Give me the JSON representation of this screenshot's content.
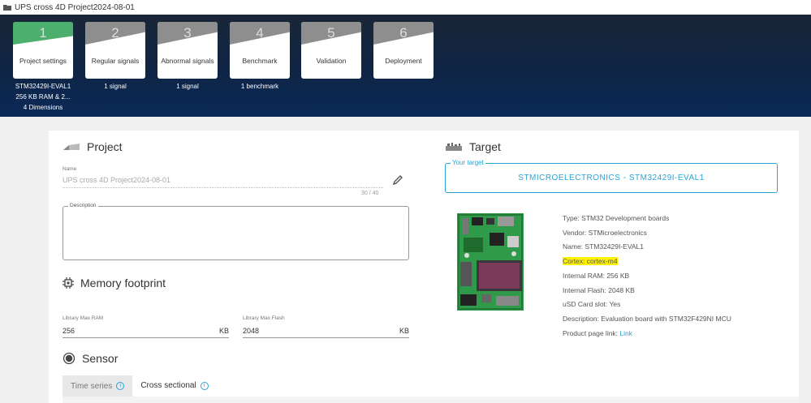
{
  "titlebar": {
    "title": "UPS cross 4D Project2024-08-01"
  },
  "steps": [
    {
      "num": "1",
      "label": "Project settings",
      "sub": [
        "STM32429I-EVAL1",
        "256 KB RAM & 2...",
        "4 Dimensions"
      ],
      "active": true
    },
    {
      "num": "2",
      "label": "Regular signals",
      "sub": [
        "1 signal"
      ],
      "active": false
    },
    {
      "num": "3",
      "label": "Abnormal signals",
      "sub": [
        "1 signal"
      ],
      "active": false
    },
    {
      "num": "4",
      "label": "Benchmark",
      "sub": [
        "1 benchmark"
      ],
      "active": false
    },
    {
      "num": "5",
      "label": "Validation",
      "sub": [],
      "active": false
    },
    {
      "num": "6",
      "label": "Deployment",
      "sub": [],
      "active": false
    }
  ],
  "project": {
    "title": "Project",
    "name_label": "Name",
    "name_value": "UPS cross 4D Project2024-08-01",
    "name_counter": "30 / 40",
    "description_label": "Description"
  },
  "memory": {
    "title": "Memory footprint",
    "ram_label": "Library Max RAM",
    "ram_value": "256",
    "ram_unit": "KB",
    "flash_label": "Library Max Flash",
    "flash_value": "2048",
    "flash_unit": "KB"
  },
  "sensor": {
    "title": "Sensor",
    "tabs": [
      "Time series",
      "Cross sectional"
    ]
  },
  "target": {
    "title": "Target",
    "your_target_label": "Your target",
    "your_target_value": "STMICROELECTRONICS - STM32429I-EVAL1",
    "specs": {
      "type": "Type: STM32 Development boards",
      "vendor": "Vendor: STMicroelectronics",
      "name": "Name: STM32429I-EVAL1",
      "cortex": "Cortex: cortex-m4",
      "ram": "Internal RAM: 256 KB",
      "flash": "Internal Flash: 2048 KB",
      "usd": "uSD Card slot: Yes",
      "description": "Description: Evaluation board with STM32F429NI MCU",
      "product_page": "Product page link: ",
      "link": "Link"
    }
  },
  "colors": {
    "accent": "#29a3d3",
    "active_step": "#4caf6e",
    "highlight": "#fff200"
  }
}
